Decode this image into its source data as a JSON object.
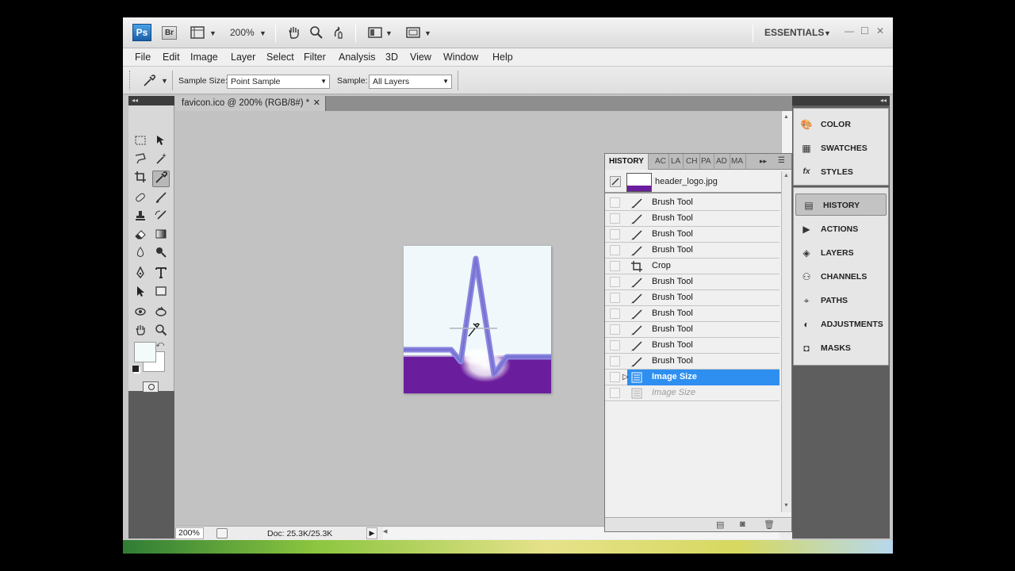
{
  "appbar": {
    "ps_logo": "Ps",
    "br_logo": "Br",
    "zoom": "200%",
    "workspace": "ESSENTIALS",
    "minimize": "—",
    "maximize": "☐",
    "close": "✕"
  },
  "menu": [
    "File",
    "Edit",
    "Image",
    "Layer",
    "Select",
    "Filter",
    "Analysis",
    "3D",
    "View",
    "Window",
    "Help"
  ],
  "options": {
    "sample_size_label": "Sample Size:",
    "sample_size_value": "Point Sample",
    "sample_label": "Sample:",
    "sample_value": "All Layers"
  },
  "document": {
    "tab_title": "favicon.ico @ 200% (RGB/8#) *",
    "tab_close": "✕",
    "status_zoom": "200%",
    "status_doc": "Doc: 25.3K/25.3K"
  },
  "history": {
    "tabs": [
      "HISTORY",
      "AC",
      "LA",
      "CH",
      "PA",
      "AD",
      "MA"
    ],
    "snapshot_name": "header_logo.jpg",
    "items": [
      {
        "label": "Brush Tool",
        "icon": "brush-icon",
        "state": "normal"
      },
      {
        "label": "Brush Tool",
        "icon": "brush-icon",
        "state": "normal"
      },
      {
        "label": "Brush Tool",
        "icon": "brush-icon",
        "state": "normal"
      },
      {
        "label": "Brush Tool",
        "icon": "brush-icon",
        "state": "normal"
      },
      {
        "label": "Crop",
        "icon": "crop-icon",
        "state": "normal"
      },
      {
        "label": "Brush Tool",
        "icon": "brush-icon",
        "state": "normal"
      },
      {
        "label": "Brush Tool",
        "icon": "brush-icon",
        "state": "normal"
      },
      {
        "label": "Brush Tool",
        "icon": "brush-icon",
        "state": "normal"
      },
      {
        "label": "Brush Tool",
        "icon": "brush-icon",
        "state": "normal"
      },
      {
        "label": "Brush Tool",
        "icon": "brush-icon",
        "state": "normal"
      },
      {
        "label": "Brush Tool",
        "icon": "brush-icon",
        "state": "normal"
      },
      {
        "label": "Image Size",
        "icon": "image-size-icon",
        "state": "selected"
      },
      {
        "label": "Image Size",
        "icon": "image-size-icon",
        "state": "undone"
      }
    ]
  },
  "dock": {
    "group1": [
      "COLOR",
      "SWATCHES",
      "STYLES"
    ],
    "group2": [
      "HISTORY",
      "ACTIONS",
      "LAYERS",
      "CHANNELS",
      "PATHS",
      "ADJUSTMENTS",
      "MASKS"
    ]
  },
  "colors": {
    "accent": "#2e8ff0",
    "image_purple": "#6a1e9e",
    "waveform": "#8a86e0",
    "foreground": "#f2fafa",
    "background": "#ffffff"
  }
}
